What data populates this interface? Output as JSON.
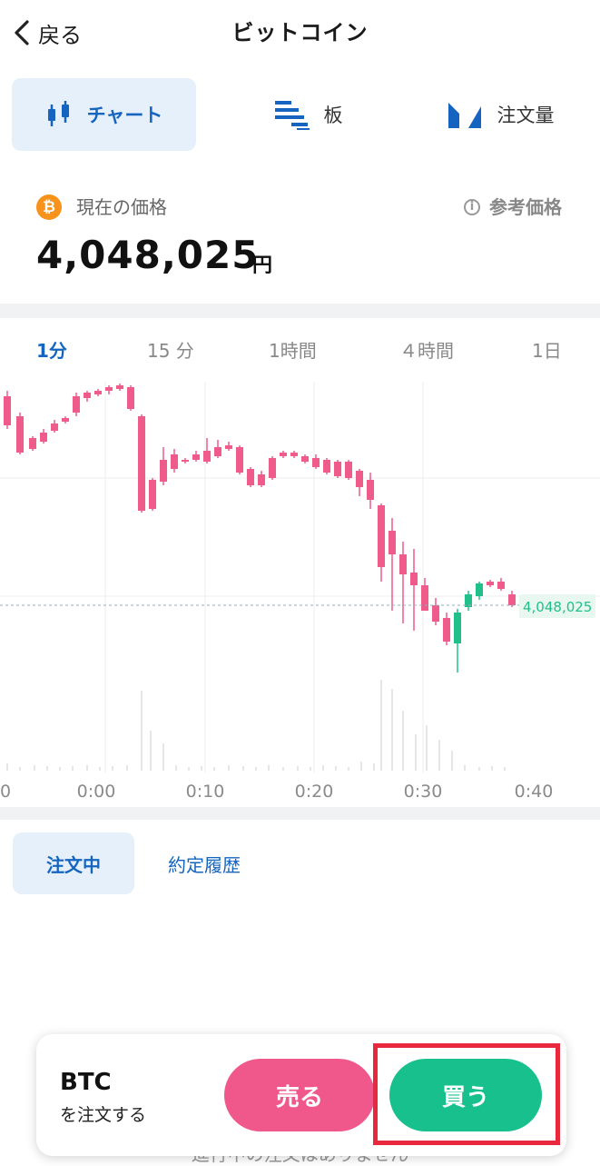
{
  "header": {
    "back_label": "戻る",
    "title": "ビットコイン"
  },
  "tabs": [
    {
      "label": "チャート",
      "icon": "candlestick-icon",
      "active": true
    },
    {
      "label": "板",
      "icon": "orderbook-icon",
      "active": false
    },
    {
      "label": "注文量",
      "icon": "order-volume-icon",
      "active": false
    }
  ],
  "price": {
    "coin_symbol": "₿",
    "label": "現在の価格",
    "reference_label": "参考価格",
    "value": "4,048,025",
    "unit": "円"
  },
  "timeframes": [
    "1分",
    "15 分",
    "1時間",
    "４時間",
    "1日"
  ],
  "active_timeframe": "1分",
  "chart_data": {
    "type": "candlestick",
    "x_tick_labels": [
      "0",
      "0:00",
      "0:10",
      "0:20",
      "0:30",
      "0:40"
    ],
    "current_price_label": "4,048,025",
    "colors": {
      "up": "#21c08b",
      "down": "#ef5b8a",
      "price_label": "#21c08b"
    }
  },
  "order_tabs": [
    "注文中",
    "約定履歴"
  ],
  "empty_message": "進行中の注文はありません",
  "order_bar": {
    "symbol": "BTC",
    "subtitle": "を注文する",
    "sell_label": "売る",
    "buy_label": "買う"
  },
  "colors": {
    "accent": "#1565c0",
    "sell": "#f0578a",
    "buy": "#17c08c",
    "highlight": "#e8283c"
  }
}
